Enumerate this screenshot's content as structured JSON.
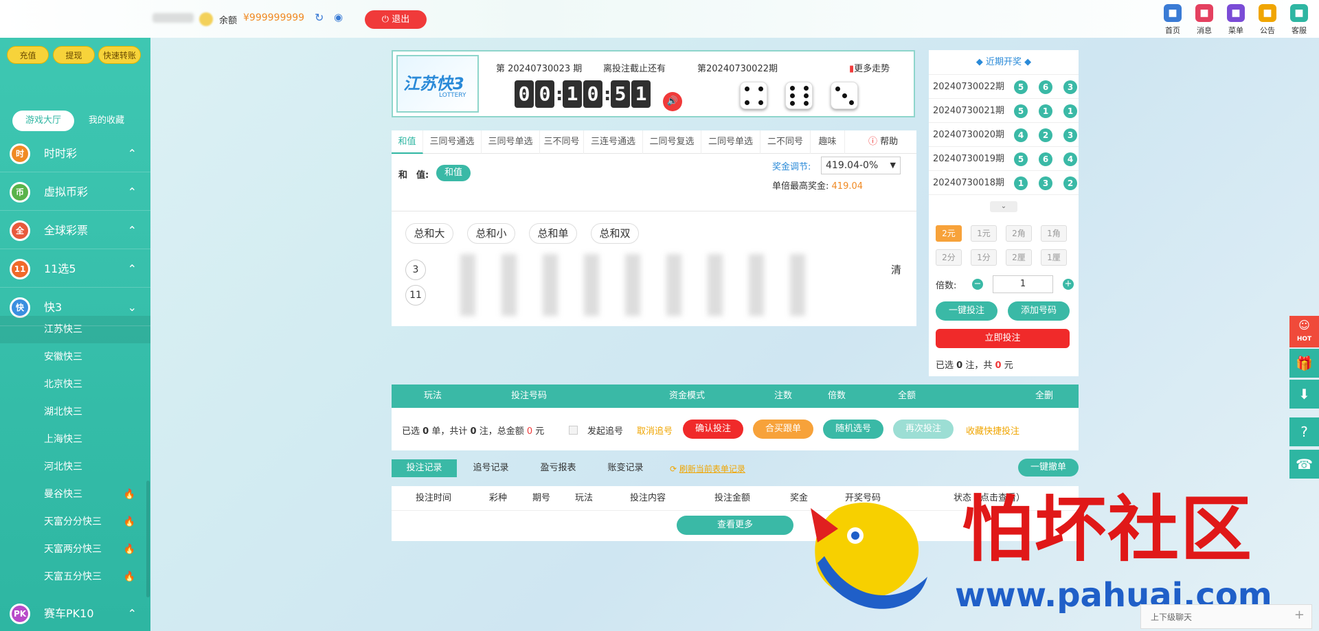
{
  "top": {
    "balance_label": "余额",
    "balance_value": "¥999999999",
    "logout": "退出",
    "nav": [
      {
        "label": "首页",
        "icon": "home-icon",
        "color": "#3a7bd5"
      },
      {
        "label": "消息",
        "icon": "mail-icon",
        "color": "#e4405f"
      },
      {
        "label": "菜单",
        "icon": "menu-grid-icon",
        "color": "#7a4bd6"
      },
      {
        "label": "公告",
        "icon": "announcement-icon",
        "color": "#f0a500"
      },
      {
        "label": "客服",
        "icon": "customer-service-icon",
        "color": "#2eb6a2"
      }
    ]
  },
  "sidebar": {
    "buttons": [
      "充值",
      "提现",
      "快速转账"
    ],
    "tabs": [
      "游戏大厅",
      "我的收藏"
    ],
    "categories": [
      {
        "label": "时时彩",
        "ball": "时",
        "color": "#f08a24"
      },
      {
        "label": "虚拟币彩",
        "ball": "币",
        "color": "#59b34a"
      },
      {
        "label": "全球彩票",
        "ball": "全",
        "color": "#e85a3c"
      },
      {
        "label": "11选5",
        "ball": "11",
        "color": "#f06a2a"
      },
      {
        "label": "快3",
        "ball": "快",
        "color": "#3a8fe0"
      }
    ],
    "subitems": [
      {
        "label": "江苏快三",
        "hot": false
      },
      {
        "label": "安徽快三",
        "hot": false
      },
      {
        "label": "北京快三",
        "hot": false
      },
      {
        "label": "湖北快三",
        "hot": false
      },
      {
        "label": "上海快三",
        "hot": false
      },
      {
        "label": "河北快三",
        "hot": false
      },
      {
        "label": "曼谷快三",
        "hot": true
      },
      {
        "label": "天富分分快三",
        "hot": true
      },
      {
        "label": "天富两分快三",
        "hot": true
      },
      {
        "label": "天富五分快三",
        "hot": true
      }
    ],
    "last_category": {
      "label": "赛车PK10",
      "ball": "PK",
      "color": "#b84ac9"
    }
  },
  "lottery": {
    "logo_text": "江苏快3",
    "logo_sub": "LOTTERY",
    "current_issue": "第 20240730023 期",
    "deadline_label": "离投注截止还有",
    "countdown": [
      "0",
      "0",
      "1",
      "0",
      "5",
      "1"
    ],
    "last_issue": "第20240730022期",
    "trend_link": "更多走势",
    "dice": [
      4,
      6,
      3
    ]
  },
  "play": {
    "tabs": [
      "和值",
      "三同号通选",
      "三同号单选",
      "三不同号",
      "三连号通选",
      "二同号复选",
      "二同号单选",
      "二不同号",
      "趣味"
    ],
    "help": "帮助",
    "row_label": "和　值:",
    "row_chip": "和值",
    "bonus_label": "奖金调节:",
    "bonus_select": "419.04-0%",
    "max_bonus_label": "单倍最高奖金:",
    "max_bonus_value": "419.04",
    "quick_picks": [
      "总和大",
      "总和小",
      "总和单",
      "总和双"
    ],
    "numbers": [
      "3",
      "11"
    ],
    "clear": "清"
  },
  "recent": {
    "title": "近期开奖",
    "rows": [
      {
        "issue": "20240730022期",
        "balls": [
          "5",
          "6",
          "3"
        ]
      },
      {
        "issue": "20240730021期",
        "balls": [
          "5",
          "1",
          "1"
        ]
      },
      {
        "issue": "20240730020期",
        "balls": [
          "4",
          "2",
          "3"
        ]
      },
      {
        "issue": "20240730019期",
        "balls": [
          "5",
          "6",
          "4"
        ]
      },
      {
        "issue": "20240730018期",
        "balls": [
          "1",
          "3",
          "2"
        ]
      }
    ],
    "units_row1": [
      "2元",
      "1元",
      "2角",
      "1角"
    ],
    "units_row2": [
      "2分",
      "1分",
      "2厘",
      "1厘"
    ],
    "multiplier_label": "倍数:",
    "multiplier_value": "1",
    "one_click": "一键投注",
    "add_number": "添加号码",
    "bet_now": "立即投注",
    "summary_pre": "已选",
    "summary_count": "0",
    "summary_mid": "注，共",
    "summary_amount": "0",
    "summary_unit": "元"
  },
  "cart": {
    "headers": [
      "玩法",
      "投注号码",
      "资金模式",
      "注数",
      "倍数",
      "全额",
      "全删"
    ],
    "summary_pre": "已选",
    "summary_count": "0",
    "summary_mid1": "单，共计",
    "summary_bets": "0",
    "summary_mid2": "注，总金额",
    "summary_amount": "0",
    "summary_unit": "元",
    "chase_label": "发起追号",
    "cancel_chase": "取消追号",
    "confirm": "确认投注",
    "group_buy": "合买跟单",
    "random": "随机选号",
    "rebet": "再次投注",
    "fav": "收藏快捷投注"
  },
  "records": {
    "tabs": [
      "投注记录",
      "追号记录",
      "盈亏报表",
      "账变记录"
    ],
    "refresh": "刷新当前表单记录",
    "cancel_all": "一键撤单",
    "columns": [
      "投注时间",
      "彩种",
      "期号",
      "玩法",
      "投注内容",
      "投注金额",
      "奖金",
      "开奖号码",
      "状态（点击查看）"
    ],
    "more": "查看更多"
  },
  "float": {
    "hot": "HOT"
  },
  "watermark": {
    "text": "怕坏社区",
    "url": "www.pahuai.com"
  },
  "chat": {
    "label": "上下级聊天",
    "plus": "+"
  }
}
